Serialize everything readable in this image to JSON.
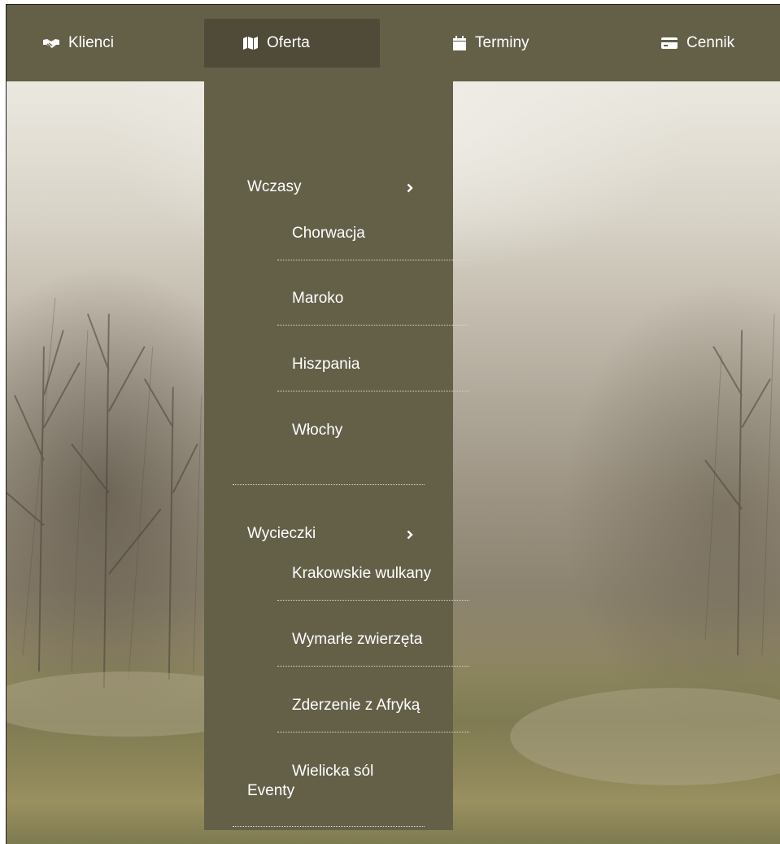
{
  "nav": {
    "items": [
      {
        "label": "Klienci",
        "icon": "handshake-icon"
      },
      {
        "label": "Oferta",
        "icon": "map-icon",
        "active": true
      },
      {
        "label": "Terminy",
        "icon": "calendar-icon"
      },
      {
        "label": "Cennik",
        "icon": "credit-card-icon"
      }
    ]
  },
  "dropdown": {
    "wczasy": {
      "label": "Wczasy",
      "items": [
        "Chorwacja",
        "Maroko",
        "Hiszpania",
        "Włochy"
      ]
    },
    "wycieczki": {
      "label": "Wycieczki",
      "items": [
        "Krakowskie wulkany",
        "Wymarłe zwierzęta",
        "Zderzenie z Afryką",
        "Wielicka sól"
      ]
    },
    "eventy": {
      "label": "Eventy"
    }
  },
  "colors": {
    "nav_bg": "#646048",
    "nav_active": "#4f4b38",
    "text": "#ffffff"
  }
}
